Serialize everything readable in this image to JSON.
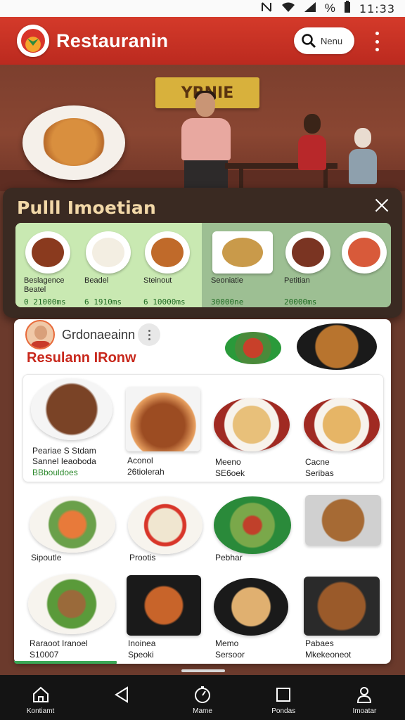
{
  "status_bar": {
    "time": "11:33",
    "icons": [
      "nfc-icon",
      "wifi-icon",
      "signal-icon",
      "battery-icon"
    ],
    "battery_label": "%"
  },
  "app_bar": {
    "title": "Restauranin",
    "search_label": "Nenu",
    "brand_color": "#c9301f"
  },
  "hero": {
    "sign_text": "YRNIE"
  },
  "popup": {
    "title": "Pulll Imoetian",
    "items": [
      {
        "name": "Beslagence\nBeatel",
        "price": "0 21000ms",
        "color": "#8a3a1e"
      },
      {
        "name": "Beadel",
        "price": "6 1910ms",
        "color": "#f3eee2"
      },
      {
        "name": "Steinout",
        "price": "6 10000ms",
        "color": "#c06a2a"
      },
      {
        "name": "Seoniatie",
        "price": "30000ne",
        "color": "#c99a4a"
      },
      {
        "name": "Petitian",
        "price": "20000ms",
        "color": "#7a3422"
      }
    ]
  },
  "sheet": {
    "user_name": "Grdonaeainn",
    "title": "Resulann IRonw",
    "rows": [
      [
        {
          "lines": [
            "Peariae S Stdam",
            "Sannel Ieaoboda"
          ],
          "green": "BBbouldoes"
        },
        {
          "lines": [
            "Aconol",
            "26tiolerah"
          ]
        },
        {
          "lines": [
            "Meeno",
            "SE6oek"
          ]
        },
        {
          "lines": [
            "Cacne",
            "Seribas"
          ]
        }
      ],
      [
        {
          "lines": [
            "Sipoutle"
          ]
        },
        {
          "lines": [
            "Prootis"
          ]
        },
        {
          "lines": [
            "Pebhar"
          ]
        },
        {
          "lines": []
        }
      ],
      [
        {
          "lines": [
            "Raraoot Iranoel",
            "S10007"
          ]
        },
        {
          "lines": [
            "Inoinea",
            "Speoki"
          ]
        },
        {
          "lines": [
            "Memo",
            "Sersoor"
          ]
        },
        {
          "lines": [
            "Pabaes",
            "Mkekeoneot"
          ]
        }
      ]
    ]
  },
  "bottom_nav": [
    {
      "label": "Kontiamt",
      "icon": "home-icon"
    },
    {
      "label": "",
      "icon": "back-icon"
    },
    {
      "label": "Mame",
      "icon": "timer-icon"
    },
    {
      "label": "Pondas",
      "icon": "square-icon"
    },
    {
      "label": "Imoatar",
      "icon": "profile-icon"
    }
  ]
}
